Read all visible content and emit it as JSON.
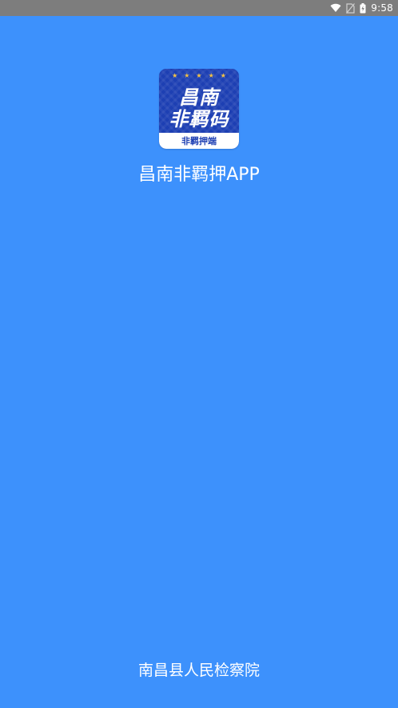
{
  "status_bar": {
    "time": "9:58",
    "icons": [
      "wifi-icon",
      "no-sim-icon",
      "battery-charging-icon"
    ]
  },
  "app_icon": {
    "line1": "昌南",
    "line2": "非羁码",
    "band_text": "非羁押端",
    "stars": "★★★★★"
  },
  "app_title": "昌南非羁押APP",
  "footer_org": "南昌县人民检察院",
  "colors": {
    "background": "#3d91fc",
    "status_bar": "#7d7d7d",
    "icon_blue": "#1d3fb3",
    "star_gold": "#f6c342",
    "text": "#ffffff"
  }
}
